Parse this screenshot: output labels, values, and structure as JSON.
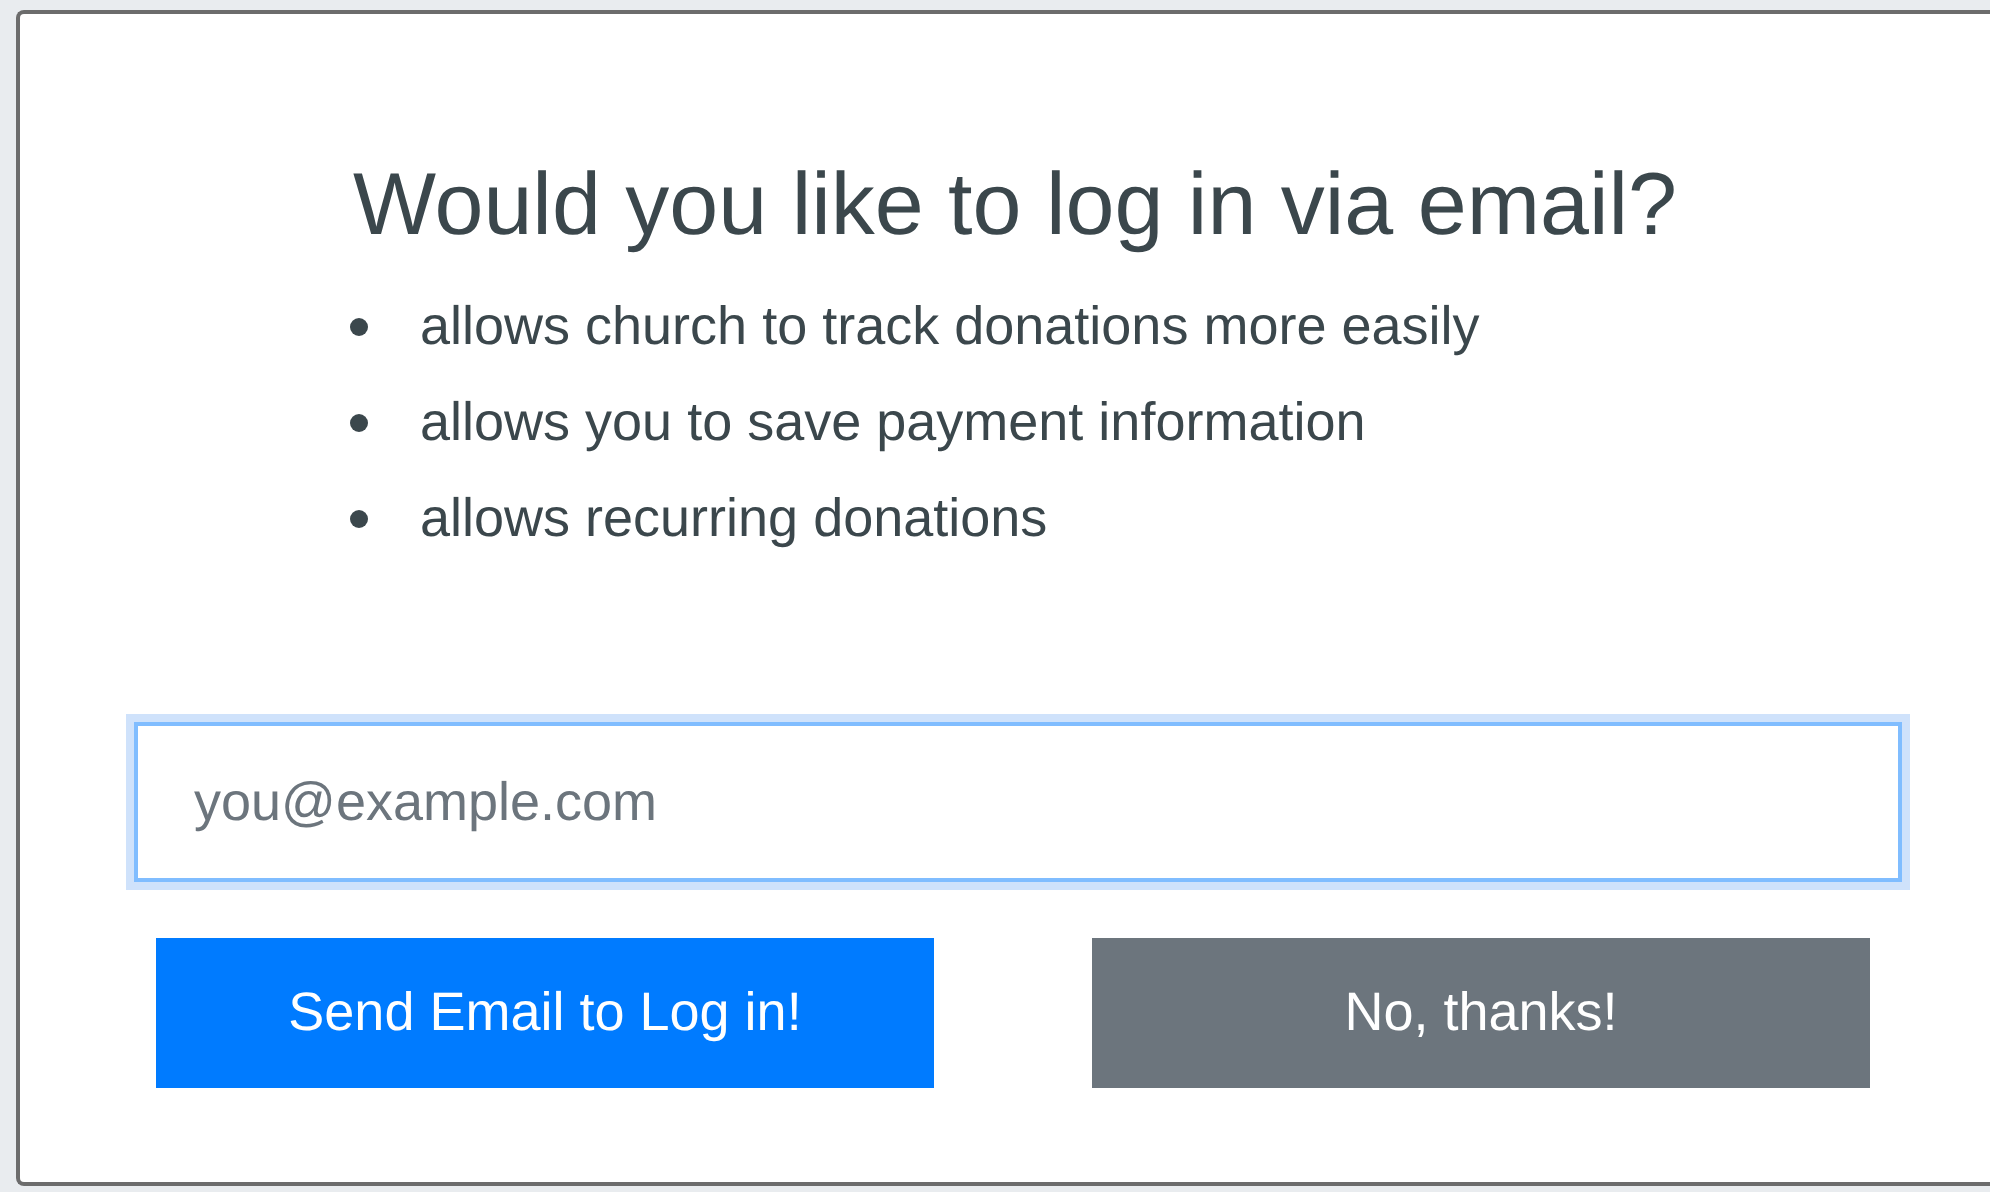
{
  "dialog": {
    "title": "Would you like to log in via email?",
    "benefits": [
      "allows church to track donations more easily",
      "allows you to save payment information",
      "allows recurring donations"
    ],
    "email_field": {
      "placeholder": "you@example.com",
      "focused": true
    },
    "buttons": [
      {
        "label": "Send Email to Log in!",
        "kind": "primary"
      },
      {
        "label": "No, thanks!",
        "kind": "secondary"
      }
    ]
  }
}
